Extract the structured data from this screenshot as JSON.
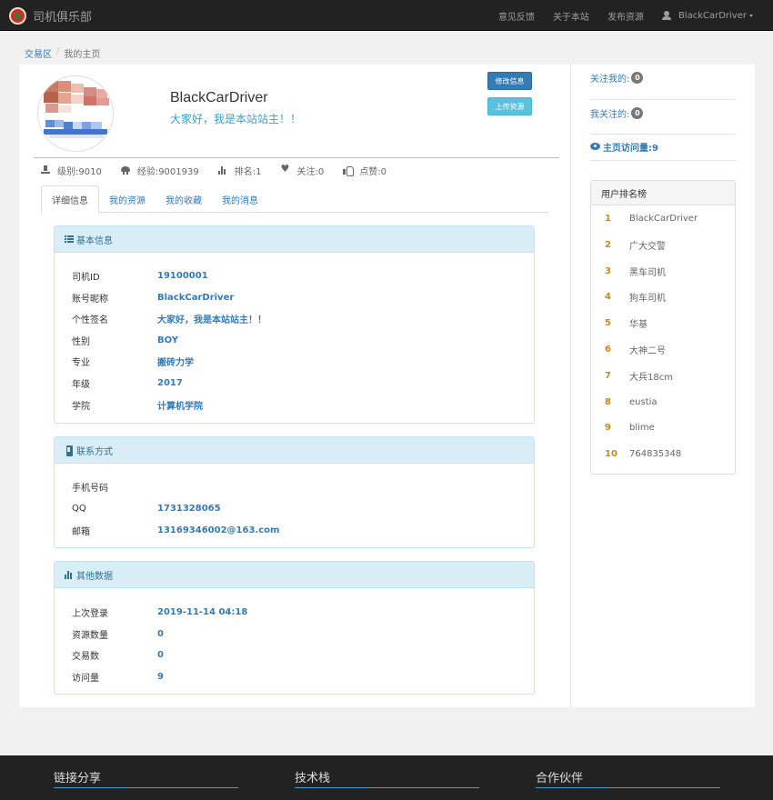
{
  "navbar": {
    "brand": "司机俱乐部",
    "links": [
      "意见反馈",
      "关于本站",
      "发布资源"
    ],
    "user": "BlackCarDriver"
  },
  "breadcrumb": {
    "parent": "交易区",
    "current": "我的主页"
  },
  "profile": {
    "name": "BlackCarDriver",
    "motto": "大家好，我是本站站主！！",
    "edit_button": "修改信息",
    "upload_button": "上传资源",
    "stats": {
      "level": "级别:9010",
      "exp": "经验:9001939",
      "rank": "排名:1",
      "follow": "关注:0",
      "likes": "点赞:0"
    }
  },
  "tabs": [
    "详细信息",
    "我的资源",
    "我的收藏",
    "我的消息"
  ],
  "panels": {
    "basic": {
      "title": "基本信息",
      "rows": [
        {
          "label": "司机ID",
          "value": "19100001"
        },
        {
          "label": "账号昵称",
          "value": "BlackCarDriver"
        },
        {
          "label": "个性签名",
          "value": "大家好，我是本站站主！！"
        },
        {
          "label": "性别",
          "value": "BOY"
        },
        {
          "label": "专业",
          "value": "搬砖力学"
        },
        {
          "label": "年级",
          "value": "2017"
        },
        {
          "label": "学院",
          "value": "计算机学院"
        }
      ]
    },
    "contact": {
      "title": "联系方式",
      "rows": [
        {
          "label": "手机号码",
          "value": ""
        },
        {
          "label": "QQ",
          "value": "1731328065"
        },
        {
          "label": "邮箱",
          "value": "13169346002@163.com"
        }
      ]
    },
    "other": {
      "title": "其他数据",
      "rows": [
        {
          "label": "上次登录",
          "value": "2019-11-14 04:18"
        },
        {
          "label": "资源数量",
          "value": "0"
        },
        {
          "label": "交易数",
          "value": "0"
        },
        {
          "label": "访问量",
          "value": "9"
        }
      ]
    }
  },
  "sidebar": {
    "followers_label": "关注我的:",
    "followers_count": "0",
    "following_label": "我关注的:",
    "following_count": "0",
    "visits": "主页访问量:9",
    "ranking": {
      "title": "用户排名榜",
      "items": [
        {
          "rank": "1",
          "name": "BlackCarDriver"
        },
        {
          "rank": "2",
          "name": "广大交警"
        },
        {
          "rank": "3",
          "name": "黑车司机"
        },
        {
          "rank": "4",
          "name": "狗车司机"
        },
        {
          "rank": "5",
          "name": "华基"
        },
        {
          "rank": "6",
          "name": "大神二号"
        },
        {
          "rank": "7",
          "name": "大兵18cm"
        },
        {
          "rank": "8",
          "name": "eustia"
        },
        {
          "rank": "9",
          "name": "blime"
        },
        {
          "rank": "10",
          "name": "764835348"
        }
      ]
    }
  },
  "footer": [
    "链接分享",
    "技术栈",
    "合作伙伴"
  ]
}
